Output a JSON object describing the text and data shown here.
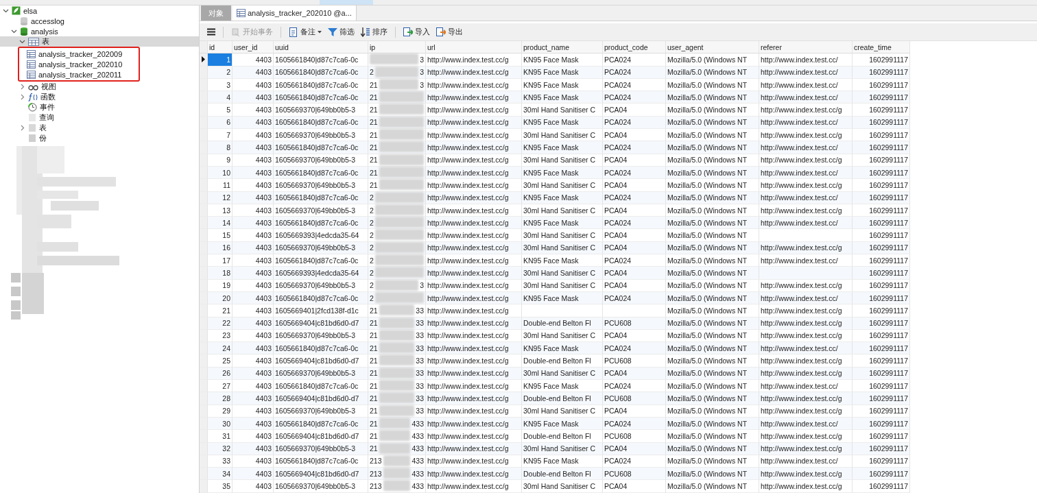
{
  "tree": [
    {
      "label": "elsa",
      "kind": "server",
      "expanded": true,
      "children": [
        {
          "label": "accesslog",
          "kind": "db-off"
        },
        {
          "label": "analysis",
          "kind": "db",
          "expanded": true,
          "children": [
            {
              "label": "表",
              "kind": "tables",
              "expanded": true,
              "selected": true,
              "highlighted": true,
              "children": [
                {
                  "label": "analysis_tracker_202009",
                  "kind": "table"
                },
                {
                  "label": "analysis_tracker_202010",
                  "kind": "table"
                },
                {
                  "label": "analysis_tracker_202011",
                  "kind": "table"
                }
              ]
            },
            {
              "label": "视图",
              "kind": "view",
              "expanded": false
            },
            {
              "label": "函数",
              "kind": "function",
              "expanded": false
            },
            {
              "label": "事件",
              "kind": "event"
            },
            {
              "label": "查询",
              "kind": "query"
            },
            {
              "label": "表",
              "kind": "report",
              "expanded": false
            },
            {
              "label": "份",
              "kind": "backup"
            }
          ]
        }
      ]
    }
  ],
  "tabs": [
    {
      "label": "对象",
      "selected": false
    },
    {
      "label": "analysis_tracker_202010 @a...",
      "selected": true
    }
  ],
  "toolbar": [
    {
      "label": "开始事务",
      "kind": "transaction",
      "disabled": true,
      "separator_before": true
    },
    {
      "label": "备注",
      "kind": "note",
      "dropdown": true,
      "separator_before": true
    },
    {
      "label": "筛选",
      "kind": "filter"
    },
    {
      "label": "排序",
      "kind": "sort"
    },
    {
      "label": "导入",
      "kind": "import",
      "separator_before": true
    },
    {
      "label": "导出",
      "kind": "export"
    }
  ],
  "table": {
    "columns": [
      "id",
      "user_id",
      "uuid",
      "ip",
      "url",
      "product_name",
      "product_code",
      "user_agent",
      "referer",
      "create_time"
    ],
    "rows": [
      {
        "selected": true,
        "cells": [
          "1",
          "4403",
          "1605661840|d87c7ca6-0c",
          {
            "end": "3"
          },
          "http://www.index.test.cc/g",
          "KN95 Face Mask",
          "PCA024",
          "Mozilla/5.0 (Windows NT",
          "http://www.index.test.cc/",
          "1602991117"
        ]
      },
      {
        "selected": false,
        "cells": [
          "2",
          "4403",
          "1605661840|d87c7ca6-0c",
          {
            "start": "2",
            "end": "3"
          },
          "http://www.index.test.cc/g",
          "KN95 Face Mask",
          "PCA024",
          "Mozilla/5.0 (Windows NT",
          "http://www.index.test.cc/",
          "1602991117"
        ]
      },
      {
        "selected": false,
        "cells": [
          "3",
          "4403",
          "1605661840|d87c7ca6-0c",
          {
            "start": "21",
            "end": "3"
          },
          "http://www.index.test.cc/g",
          "KN95 Face Mask",
          "PCA024",
          "Mozilla/5.0 (Windows NT",
          "http://www.index.test.cc/",
          "1602991117"
        ]
      },
      {
        "selected": false,
        "cells": [
          "4",
          "4403",
          "1605661840|d87c7ca6-0c",
          {
            "start": "21"
          },
          "http://www.index.test.cc/g",
          "KN95 Face Mask",
          "PCA024",
          "Mozilla/5.0 (Windows NT",
          "http://www.index.test.cc/",
          "1602991117"
        ]
      },
      {
        "selected": false,
        "cells": [
          "5",
          "4403",
          "1605669370|649bb0b5-3",
          {
            "start": "21"
          },
          "http://www.index.test.cc/g",
          "30ml Hand Sanitiser C",
          "PCA04",
          "Mozilla/5.0 (Windows NT",
          "http://www.index.test.cc/g",
          "1602991117"
        ]
      },
      {
        "selected": false,
        "cells": [
          "6",
          "4403",
          "1605661840|d87c7ca6-0c",
          {
            "start": "21"
          },
          "http://www.index.test.cc/g",
          "KN95 Face Mask",
          "PCA024",
          "Mozilla/5.0 (Windows NT",
          "http://www.index.test.cc/",
          "1602991117"
        ]
      },
      {
        "selected": false,
        "cells": [
          "7",
          "4403",
          "1605669370|649bb0b5-3",
          {
            "start": "21"
          },
          "http://www.index.test.cc/g",
          "30ml Hand Sanitiser C",
          "PCA04",
          "Mozilla/5.0 (Windows NT",
          "http://www.index.test.cc/g",
          "1602991117"
        ]
      },
      {
        "selected": false,
        "cells": [
          "8",
          "4403",
          "1605661840|d87c7ca6-0c",
          {
            "start": "21"
          },
          "http://www.index.test.cc/g",
          "KN95 Face Mask",
          "PCA024",
          "Mozilla/5.0 (Windows NT",
          "http://www.index.test.cc/",
          "1602991117"
        ]
      },
      {
        "selected": false,
        "cells": [
          "9",
          "4403",
          "1605669370|649bb0b5-3",
          {
            "start": "21"
          },
          "http://www.index.test.cc/g",
          "30ml Hand Sanitiser C",
          "PCA04",
          "Mozilla/5.0 (Windows NT",
          "http://www.index.test.cc/g",
          "1602991117"
        ]
      },
      {
        "selected": false,
        "cells": [
          "10",
          "4403",
          "1605661840|d87c7ca6-0c",
          {
            "start": "21"
          },
          "http://www.index.test.cc/g",
          "KN95 Face Mask",
          "PCA024",
          "Mozilla/5.0 (Windows NT",
          "http://www.index.test.cc/",
          "1602991117"
        ]
      },
      {
        "selected": false,
        "cells": [
          "11",
          "4403",
          "1605669370|649bb0b5-3",
          {
            "start": "21"
          },
          "http://www.index.test.cc/g",
          "30ml Hand Sanitiser C",
          "PCA04",
          "Mozilla/5.0 (Windows NT",
          "http://www.index.test.cc/g",
          "1602991117"
        ]
      },
      {
        "selected": false,
        "cells": [
          "12",
          "4403",
          "1605661840|d87c7ca6-0c",
          {
            "start": "2"
          },
          "http://www.index.test.cc/g",
          "KN95 Face Mask",
          "PCA024",
          "Mozilla/5.0 (Windows NT",
          "http://www.index.test.cc/",
          "1602991117"
        ]
      },
      {
        "selected": false,
        "cells": [
          "13",
          "4403",
          "1605669370|649bb0b5-3",
          {
            "start": "2"
          },
          "http://www.index.test.cc/g",
          "30ml Hand Sanitiser C",
          "PCA04",
          "Mozilla/5.0 (Windows NT",
          "http://www.index.test.cc/g",
          "1602991117"
        ]
      },
      {
        "selected": false,
        "cells": [
          "14",
          "4403",
          "1605661840|d87c7ca6-0c",
          {
            "start": "2"
          },
          "http://www.index.test.cc/g",
          "KN95 Face Mask",
          "PCA024",
          "Mozilla/5.0 (Windows NT",
          "http://www.index.test.cc/",
          "1602991117"
        ]
      },
      {
        "selected": false,
        "cells": [
          "15",
          "4403",
          "1605669393|4edcda35-64",
          {
            "start": "2"
          },
          "http://www.index.test.cc/g",
          "30ml Hand Sanitiser C",
          "PCA04",
          "Mozilla/5.0 (Windows NT",
          null,
          "1602991117"
        ]
      },
      {
        "selected": false,
        "cells": [
          "16",
          "4403",
          "1605669370|649bb0b5-3",
          {
            "start": "2"
          },
          "http://www.index.test.cc/g",
          "30ml Hand Sanitiser C",
          "PCA04",
          "Mozilla/5.0 (Windows NT",
          "http://www.index.test.cc/g",
          "1602991117"
        ]
      },
      {
        "selected": false,
        "cells": [
          "17",
          "4403",
          "1605661840|d87c7ca6-0c",
          {
            "start": "2"
          },
          "http://www.index.test.cc/g",
          "KN95 Face Mask",
          "PCA024",
          "Mozilla/5.0 (Windows NT",
          "http://www.index.test.cc/",
          "1602991117"
        ]
      },
      {
        "selected": false,
        "cells": [
          "18",
          "4403",
          "1605669393|4edcda35-64",
          {
            "start": "2"
          },
          "http://www.index.test.cc/g",
          "30ml Hand Sanitiser C",
          "PCA04",
          "Mozilla/5.0 (Windows NT",
          null,
          "1602991117"
        ]
      },
      {
        "selected": false,
        "cells": [
          "19",
          "4403",
          "1605669370|649bb0b5-3",
          {
            "start": "2",
            "end": "3"
          },
          "http://www.index.test.cc/g",
          "30ml Hand Sanitiser C",
          "PCA04",
          "Mozilla/5.0 (Windows NT",
          "http://www.index.test.cc/g",
          "1602991117"
        ]
      },
      {
        "selected": false,
        "cells": [
          "20",
          "4403",
          "1605661840|d87c7ca6-0c",
          {
            "start": "2"
          },
          "http://www.index.test.cc/g",
          "KN95 Face Mask",
          "PCA024",
          "Mozilla/5.0 (Windows NT",
          "http://www.index.test.cc/",
          "1602991117"
        ]
      },
      {
        "selected": false,
        "cells": [
          "21",
          "4403",
          "1605669401|2fcd138f-d1c",
          {
            "start": "21",
            "end": "33"
          },
          "http://www.index.test.cc/g",
          null,
          null,
          "Mozilla/5.0 (Windows NT",
          "http://www.index.test.cc/g",
          "1602991117"
        ]
      },
      {
        "selected": false,
        "cells": [
          "22",
          "4403",
          "1605669404|c81bd6d0-d7",
          {
            "start": "21",
            "end": "33"
          },
          "http://www.index.test.cc/g",
          "Double-end Belton Fl",
          "PCU608",
          "Mozilla/5.0 (Windows NT",
          "http://www.index.test.cc/g",
          "1602991117"
        ]
      },
      {
        "selected": false,
        "cells": [
          "23",
          "4403",
          "1605669370|649bb0b5-3",
          {
            "start": "21",
            "end": "33"
          },
          "http://www.index.test.cc/g",
          "30ml Hand Sanitiser C",
          "PCA04",
          "Mozilla/5.0 (Windows NT",
          "http://www.index.test.cc/g",
          "1602991117"
        ]
      },
      {
        "selected": false,
        "cells": [
          "24",
          "4403",
          "1605661840|d87c7ca6-0c",
          {
            "start": "21",
            "end": "33"
          },
          "http://www.index.test.cc/g",
          "KN95 Face Mask",
          "PCA024",
          "Mozilla/5.0 (Windows NT",
          "http://www.index.test.cc/",
          "1602991117"
        ]
      },
      {
        "selected": false,
        "cells": [
          "25",
          "4403",
          "1605669404|c81bd6d0-d7",
          {
            "start": "21",
            "end": "33"
          },
          "http://www.index.test.cc/g",
          "Double-end Belton Fl",
          "PCU608",
          "Mozilla/5.0 (Windows NT",
          "http://www.index.test.cc/g",
          "1602991117"
        ]
      },
      {
        "selected": false,
        "cells": [
          "26",
          "4403",
          "1605669370|649bb0b5-3",
          {
            "start": "21",
            "end": "33"
          },
          "http://www.index.test.cc/g",
          "30ml Hand Sanitiser C",
          "PCA04",
          "Mozilla/5.0 (Windows NT",
          "http://www.index.test.cc/g",
          "1602991117"
        ]
      },
      {
        "selected": false,
        "cells": [
          "27",
          "4403",
          "1605661840|d87c7ca6-0c",
          {
            "start": "21",
            "end": "33"
          },
          "http://www.index.test.cc/g",
          "KN95 Face Mask",
          "PCA024",
          "Mozilla/5.0 (Windows NT",
          "http://www.index.test.cc/",
          "1602991117"
        ]
      },
      {
        "selected": false,
        "cells": [
          "28",
          "4403",
          "1605669404|c81bd6d0-d7",
          {
            "start": "21",
            "end": "33"
          },
          "http://www.index.test.cc/g",
          "Double-end Belton Fl",
          "PCU608",
          "Mozilla/5.0 (Windows NT",
          "http://www.index.test.cc/g",
          "1602991117"
        ]
      },
      {
        "selected": false,
        "cells": [
          "29",
          "4403",
          "1605669370|649bb0b5-3",
          {
            "start": "21",
            "end": "33"
          },
          "http://www.index.test.cc/g",
          "30ml Hand Sanitiser C",
          "PCA04",
          "Mozilla/5.0 (Windows NT",
          "http://www.index.test.cc/g",
          "1602991117"
        ]
      },
      {
        "selected": false,
        "cells": [
          "30",
          "4403",
          "1605661840|d87c7ca6-0c",
          {
            "start": "21",
            "end": "433"
          },
          "http://www.index.test.cc/g",
          "KN95 Face Mask",
          "PCA024",
          "Mozilla/5.0 (Windows NT",
          "http://www.index.test.cc/",
          "1602991117"
        ]
      },
      {
        "selected": false,
        "cells": [
          "31",
          "4403",
          "1605669404|c81bd6d0-d7",
          {
            "start": "21",
            "end": "433"
          },
          "http://www.index.test.cc/g",
          "Double-end Belton Fl",
          "PCU608",
          "Mozilla/5.0 (Windows NT",
          "http://www.index.test.cc/g",
          "1602991117"
        ]
      },
      {
        "selected": false,
        "cells": [
          "32",
          "4403",
          "1605669370|649bb0b5-3",
          {
            "start": "21",
            "end": "433"
          },
          "http://www.index.test.cc/g",
          "30ml Hand Sanitiser C",
          "PCA04",
          "Mozilla/5.0 (Windows NT",
          "http://www.index.test.cc/g",
          "1602991117"
        ]
      },
      {
        "selected": false,
        "cells": [
          "33",
          "4403",
          "1605661840|d87c7ca6-0c",
          {
            "start": "213",
            "end": "433"
          },
          "http://www.index.test.cc/g",
          "KN95 Face Mask",
          "PCA024",
          "Mozilla/5.0 (Windows NT",
          "http://www.index.test.cc/",
          "1602991117"
        ]
      },
      {
        "selected": false,
        "cells": [
          "34",
          "4403",
          "1605669404|c81bd6d0-d7",
          {
            "start": "213",
            "end": "433"
          },
          "http://www.index.test.cc/g",
          "Double-end Belton Fl",
          "PCU608",
          "Mozilla/5.0 (Windows NT",
          "http://www.index.test.cc/g",
          "1602991117"
        ]
      },
      {
        "selected": false,
        "cells": [
          "35",
          "4403",
          "1605669370|649bb0b5-3",
          {
            "start": "213",
            "end": "433"
          },
          "http://www.index.test.cc/g",
          "30ml Hand Sanitiser C",
          "PCA04",
          "Mozilla/5.0 (Windows NT",
          "http://www.index.test.cc/g",
          "1602991117"
        ]
      }
    ]
  }
}
